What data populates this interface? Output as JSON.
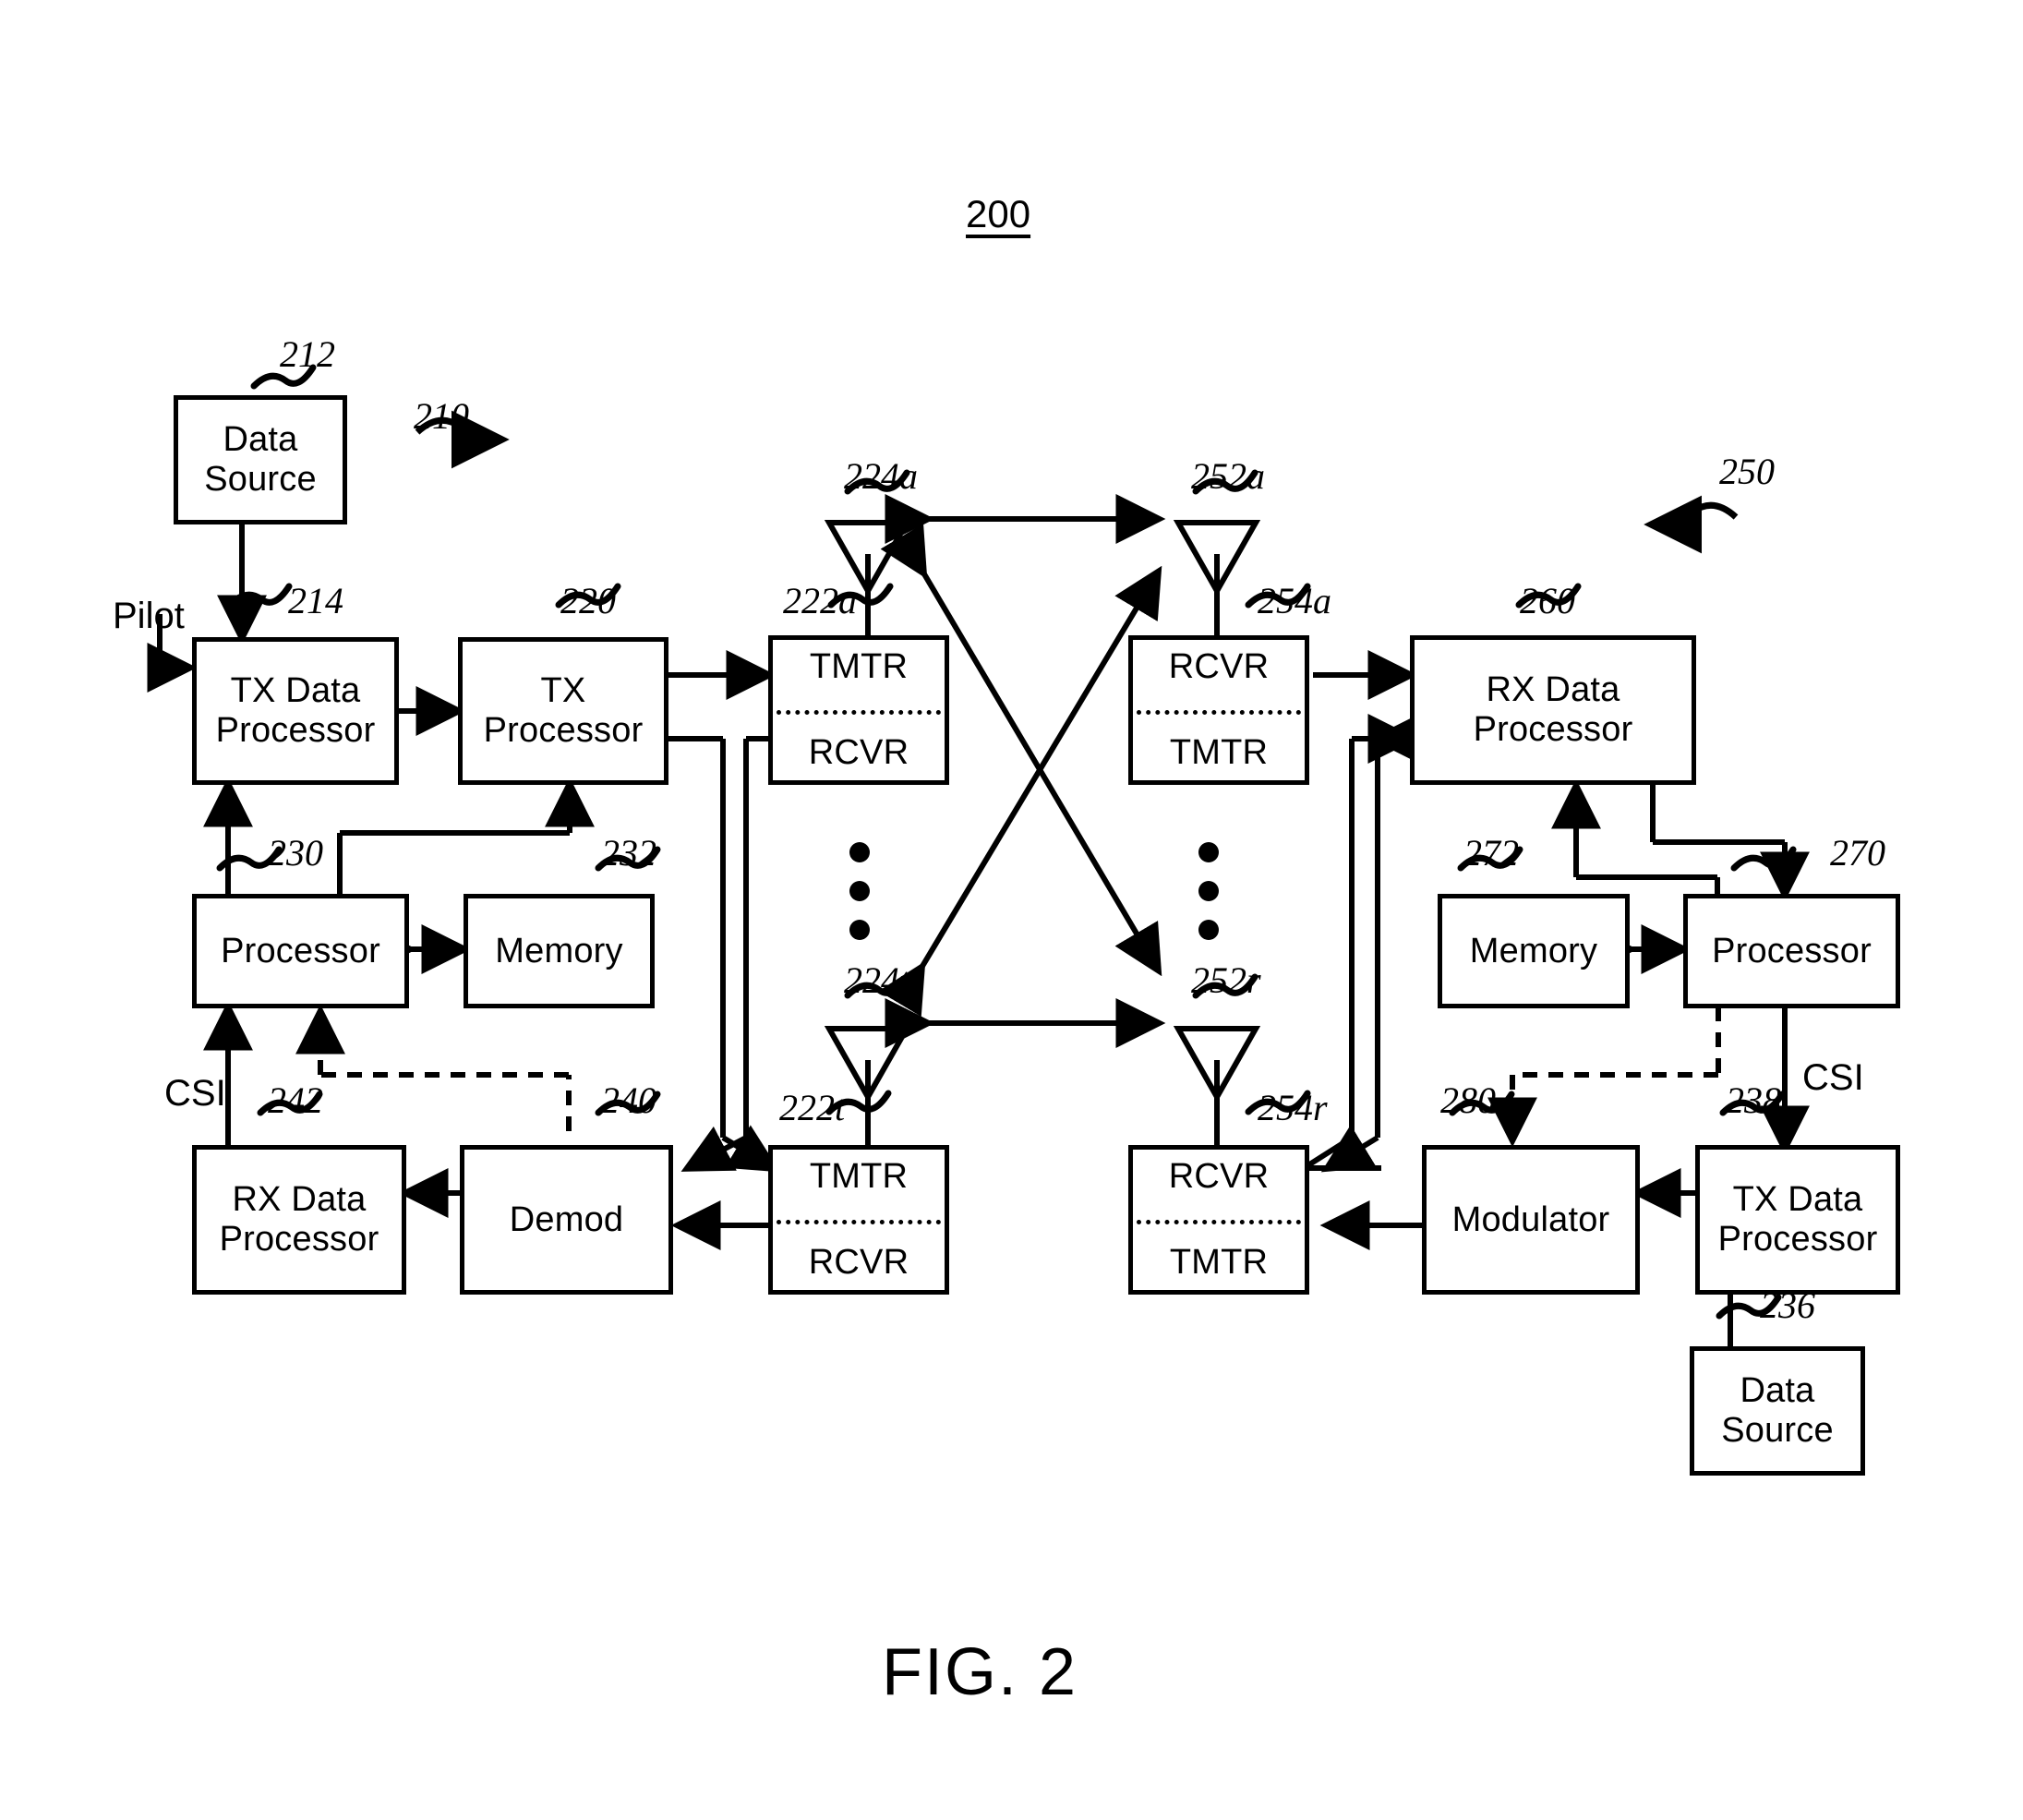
{
  "figure": {
    "number_label": "200",
    "caption": "FIG. 2"
  },
  "labels": {
    "pilot": "Pilot",
    "csi_left": "CSI",
    "csi_right": "CSI"
  },
  "blocks": [
    {
      "id": "data_source_tx",
      "lines": [
        "Data",
        "Source"
      ],
      "ref": "212"
    },
    {
      "id": "tx_data_proc",
      "lines": [
        "TX Data",
        "Processor"
      ],
      "ref": "214"
    },
    {
      "id": "tx_proc",
      "lines": [
        "TX",
        "Processor"
      ],
      "ref": "220"
    },
    {
      "id": "tmtr_rcvr_a",
      "lines": [
        "TMTR",
        "RCVR"
      ],
      "ref": "222a"
    },
    {
      "id": "tmtr_rcvr_t",
      "lines": [
        "TMTR",
        "RCVR"
      ],
      "ref": "222t"
    },
    {
      "id": "rcvr_tmtr_a",
      "lines": [
        "RCVR",
        "TMTR"
      ],
      "ref": "254a"
    },
    {
      "id": "rcvr_tmtr_r",
      "lines": [
        "RCVR",
        "TMTR"
      ],
      "ref": "254r"
    },
    {
      "id": "rx_data_proc_r",
      "lines": [
        "RX Data",
        "Processor"
      ],
      "ref": "260"
    },
    {
      "id": "processor_left",
      "lines": [
        "Processor"
      ],
      "ref": "230"
    },
    {
      "id": "memory_left",
      "lines": [
        "Memory"
      ],
      "ref": "232"
    },
    {
      "id": "memory_right",
      "lines": [
        "Memory"
      ],
      "ref": "272"
    },
    {
      "id": "processor_right",
      "lines": [
        "Processor"
      ],
      "ref": "270"
    },
    {
      "id": "rx_data_proc_l",
      "lines": [
        "RX Data",
        "Processor"
      ],
      "ref": "242"
    },
    {
      "id": "demod",
      "lines": [
        "Demod"
      ],
      "ref": "240"
    },
    {
      "id": "modulator",
      "lines": [
        "Modulator"
      ],
      "ref": "280"
    },
    {
      "id": "tx_data_proc_r",
      "lines": [
        "TX Data",
        "Processor"
      ],
      "ref": "238"
    },
    {
      "id": "data_source_rx",
      "lines": [
        "Data",
        "Source"
      ],
      "ref": "236"
    }
  ],
  "antennas": [
    {
      "id": "ant_224a",
      "ref": "224a"
    },
    {
      "id": "ant_224t",
      "ref": "224t"
    },
    {
      "id": "ant_252a",
      "ref": "252a"
    },
    {
      "id": "ant_252r",
      "ref": "252r"
    }
  ],
  "system_refs": [
    {
      "id": "system_210",
      "ref": "210"
    },
    {
      "id": "system_250",
      "ref": "250"
    }
  ],
  "colors": {
    "line": "#000000",
    "background": "#ffffff"
  }
}
